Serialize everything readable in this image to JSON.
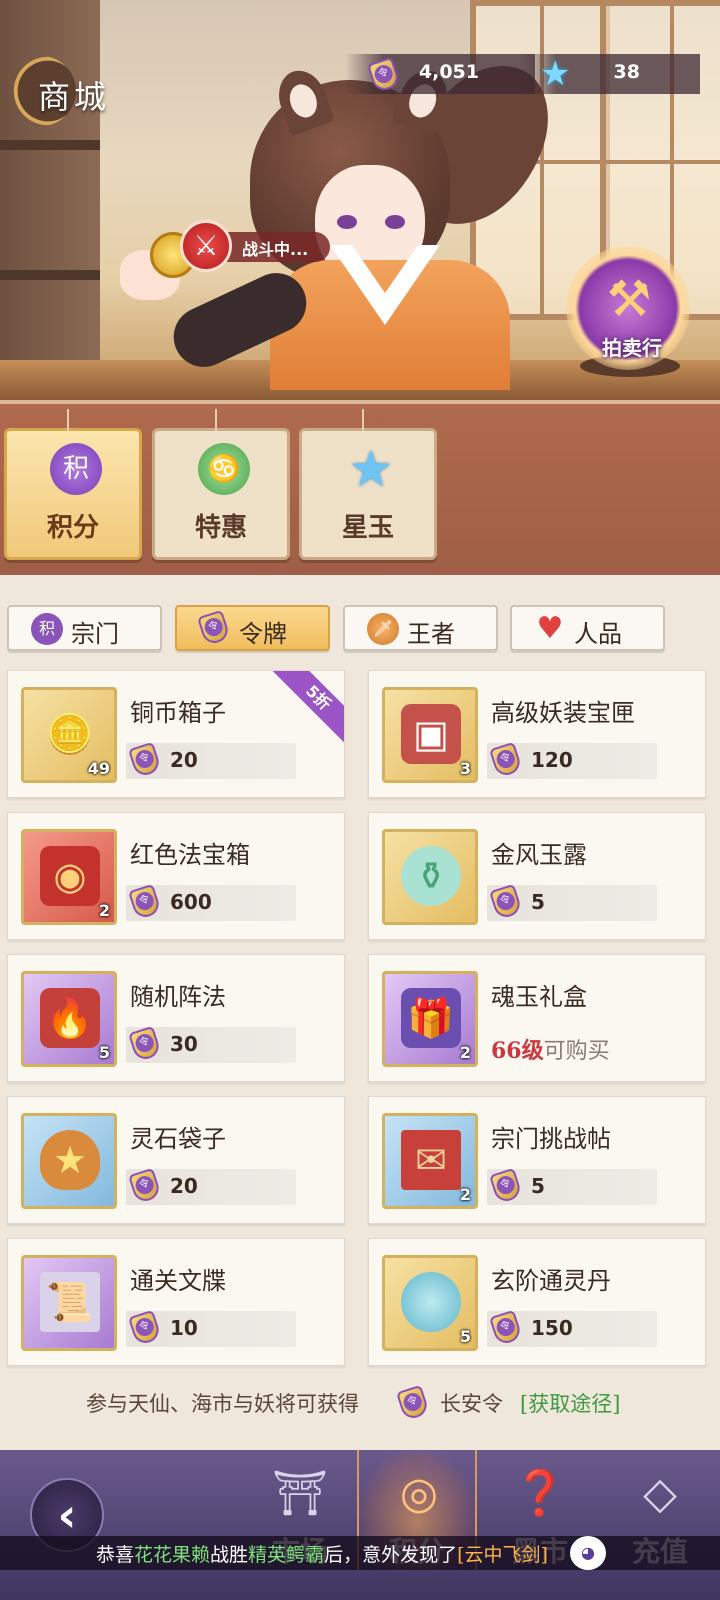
{
  "header": {
    "title": "商城",
    "currency": [
      {
        "icon": "token-icon",
        "value": "4,051"
      },
      {
        "icon": "star-jade-icon",
        "value": "38"
      }
    ],
    "battle_status": "战斗中...",
    "auction_label": "拍卖行"
  },
  "categories": [
    {
      "label": "积分",
      "icon_text": "积",
      "active": true
    },
    {
      "label": "特惠",
      "icon_text": "",
      "active": false
    },
    {
      "label": "星玉",
      "icon_text": "",
      "active": false
    }
  ],
  "tabs": [
    {
      "label": "宗门",
      "icon_text": "积",
      "active": false
    },
    {
      "label": "令牌",
      "icon_text": "",
      "active": true
    },
    {
      "label": "王者",
      "icon_text": "",
      "active": false
    },
    {
      "label": "人品",
      "icon_text": "",
      "active": false
    }
  ],
  "items": [
    {
      "name": "铜币箱子",
      "price": "20",
      "count": "49",
      "badge": "5折"
    },
    {
      "name": "高级妖装宝匣",
      "price": "120",
      "count": "3"
    },
    {
      "name": "红色法宝箱",
      "price": "600",
      "count": "2"
    },
    {
      "name": "金风玉露",
      "price": "5",
      "count": ""
    },
    {
      "name": "随机阵法",
      "price": "30",
      "count": "5"
    },
    {
      "name": "魂玉礼盒",
      "count": "2",
      "lock_level": "66级",
      "lock_text": "可购买"
    },
    {
      "name": "灵石袋子",
      "price": "20",
      "count": ""
    },
    {
      "name": "宗门挑战帖",
      "price": "5",
      "count": "2"
    },
    {
      "name": "通关文牒",
      "price": "10",
      "count": ""
    },
    {
      "name": "玄阶通灵丹",
      "price": "150",
      "count": "5"
    }
  ],
  "note": {
    "text": "参与天仙、海市与妖将可获得",
    "currency_name": "长安令",
    "link": "[获取途径]"
  },
  "bottom_nav": [
    {
      "label": "市场",
      "active": false
    },
    {
      "label": "积分",
      "active": true
    },
    {
      "label": "黑市",
      "active": false
    },
    {
      "label": "充值",
      "active": false
    }
  ],
  "ticker": {
    "prefix": "恭喜",
    "player": "花花果赖",
    "mid": "战胜",
    "enemy": "精英鳄霸",
    "suffix": "后，意外发现了",
    "reward": "[云中飞剑]"
  },
  "colors": {
    "accent_gold": "#f0bd5c",
    "accent_purple": "#9b54c6",
    "link_green": "#3f9a3f",
    "level_red": "#d0363f"
  }
}
